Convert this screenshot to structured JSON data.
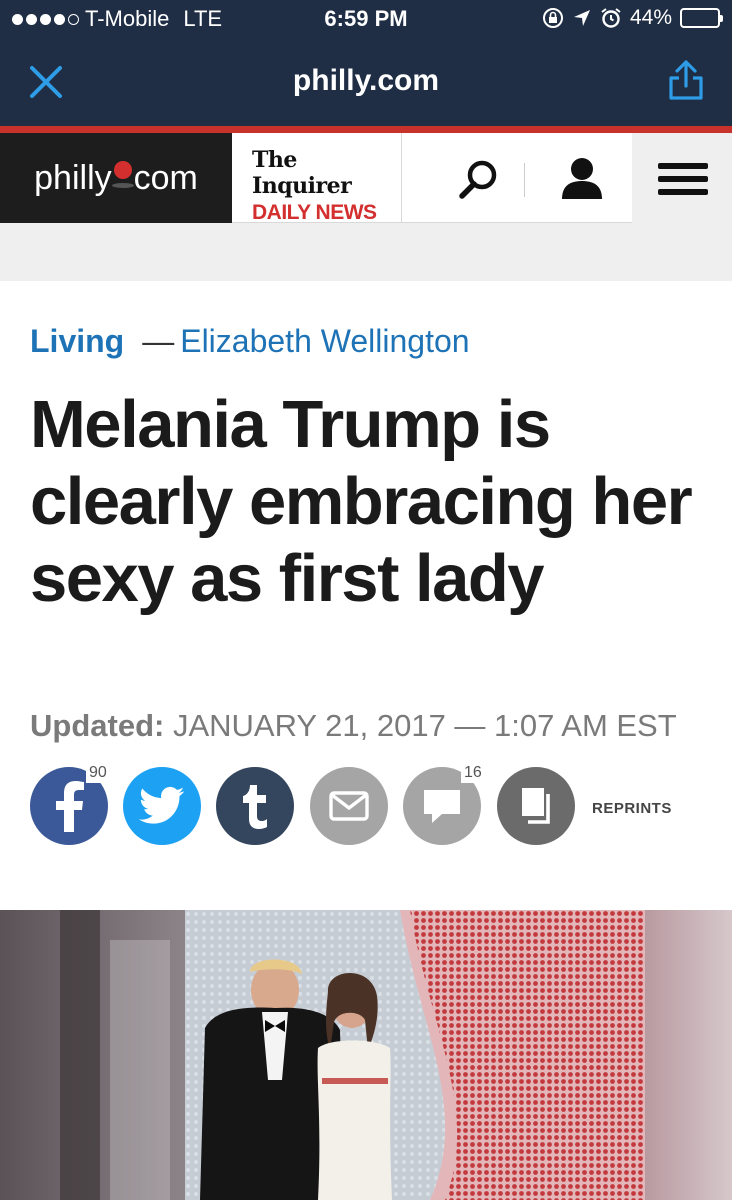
{
  "status_bar": {
    "carrier": "T-Mobile",
    "network": "LTE",
    "time": "6:59 PM",
    "battery_percent": "44%",
    "battery_level": 0.44,
    "signal_bars": 4,
    "signal_total": 5
  },
  "browser": {
    "title": "philly.com",
    "close_icon": "close-icon",
    "share_icon": "share-icon"
  },
  "site_header": {
    "logo_left": "philly",
    "logo_right": "com",
    "inquirer": "The Inquirer",
    "daily_news": "DAILY NEWS",
    "icons": [
      "search-icon",
      "user-icon",
      "menu-icon"
    ]
  },
  "article": {
    "section": "Living",
    "byline_separator": "—",
    "author": "Elizabeth Wellington",
    "headline": "Melania Trump is clearly embracing her sexy as first lady",
    "updated_label": "Updated:",
    "updated_value": "JANUARY 21, 2017 — 1:07 AM EST"
  },
  "share": {
    "facebook_count": "90",
    "comments_count": "16",
    "reprints_label": "REPRINTS"
  },
  "colors": {
    "nav_bg": "#1f2e44",
    "accent_red": "#c7322a",
    "link_blue": "#1e73b6",
    "facebook": "#3b5998",
    "twitter": "#1da1f2",
    "tumblr": "#34465d",
    "grey_icon": "#a5a5a5"
  }
}
